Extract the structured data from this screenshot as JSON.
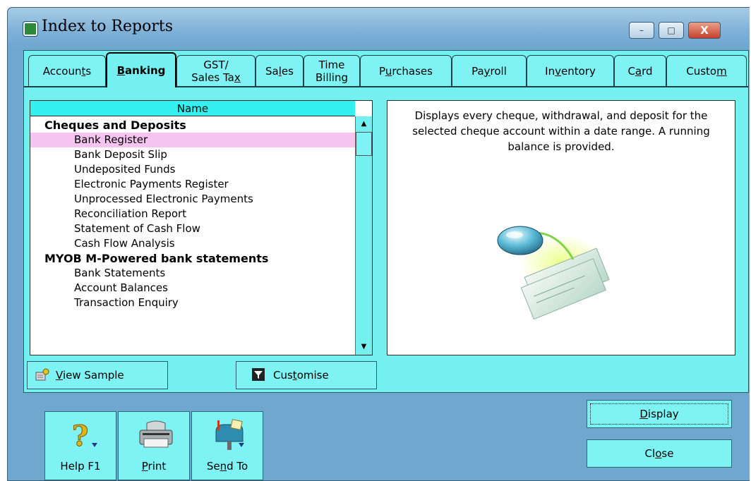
{
  "window": {
    "title": "Index to Reports",
    "controls": {
      "minimize": "–",
      "maximize": "□",
      "close": "X"
    }
  },
  "tabs": [
    {
      "pre": "Accoun",
      "u": "t",
      "post": "s",
      "active": false
    },
    {
      "pre": "",
      "u": "B",
      "post": "anking",
      "active": true
    },
    {
      "line1": "GST/",
      "pre": "Sales Ta",
      "u": "x",
      "post": "",
      "active": false
    },
    {
      "pre": "Sa",
      "u": "l",
      "post": "es",
      "active": false
    },
    {
      "line1": "Time",
      "pre": "Billing",
      "u": "",
      "post": "",
      "active": false
    },
    {
      "pre": "P",
      "u": "u",
      "post": "rchases",
      "active": false
    },
    {
      "pre": "Pa",
      "u": "y",
      "post": "roll",
      "active": false
    },
    {
      "pre": "In",
      "u": "v",
      "post": "entory",
      "active": false
    },
    {
      "pre": "C",
      "u": "a",
      "post": "rd",
      "active": false
    },
    {
      "pre": "Custo",
      "u": "m",
      "post": "",
      "active": false
    }
  ],
  "report_list": {
    "header": "Name",
    "rows": [
      {
        "text": "Cheques and Deposits",
        "kind": "group"
      },
      {
        "text": "Bank Register",
        "kind": "item",
        "selected": true
      },
      {
        "text": "Bank Deposit Slip",
        "kind": "item"
      },
      {
        "text": "Undeposited Funds",
        "kind": "item"
      },
      {
        "text": "Electronic Payments Register",
        "kind": "item"
      },
      {
        "text": "Unprocessed Electronic Payments",
        "kind": "item"
      },
      {
        "text": "Reconciliation Report",
        "kind": "item"
      },
      {
        "text": "Statement of Cash Flow",
        "kind": "item"
      },
      {
        "text": "Cash Flow Analysis",
        "kind": "item"
      },
      {
        "text": "MYOB M-Powered bank statements",
        "kind": "group"
      },
      {
        "text": "Bank Statements",
        "kind": "item"
      },
      {
        "text": "Account Balances",
        "kind": "item"
      },
      {
        "text": "Transaction Enquiry",
        "kind": "item"
      }
    ]
  },
  "description": "Displays every cheque, withdrawal, and deposit for the selected cheque account within a date range.  A running balance is provided.",
  "buttons": {
    "view_sample": {
      "pre": "",
      "u": "V",
      "post": "iew Sample"
    },
    "customise": {
      "pre": "Cus",
      "u": "t",
      "post": "omise"
    },
    "help": "Help F1",
    "print": {
      "pre": "",
      "u": "P",
      "post": "rint"
    },
    "send_to": {
      "pre": "Se",
      "u": "n",
      "post": "d To"
    },
    "display": {
      "pre": "",
      "u": "D",
      "post": "isplay"
    },
    "close": {
      "pre": "Cl",
      "u": "o",
      "post": "se"
    }
  },
  "colors": {
    "panel": "#75f0f0",
    "selected_row": "#f6c4f0",
    "window_frame": "#6fa7cf"
  }
}
